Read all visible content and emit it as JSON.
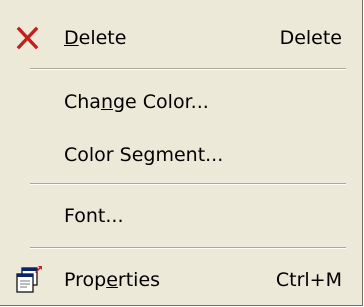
{
  "menu": {
    "items": [
      {
        "label_before": "",
        "label_accel": "D",
        "label_after": "elete",
        "shortcut": "Delete",
        "icon": "delete-x-icon"
      },
      {
        "label_before": "Cha",
        "label_accel": "n",
        "label_after": "ge Color...",
        "shortcut": "",
        "icon": ""
      },
      {
        "label_before": "Color Segment...",
        "label_accel": "",
        "label_after": "",
        "shortcut": "",
        "icon": ""
      },
      {
        "label_before": "Font...",
        "label_accel": "",
        "label_after": "",
        "shortcut": "",
        "icon": ""
      },
      {
        "label_before": "Prop",
        "label_accel": "e",
        "label_after": "rties",
        "shortcut": "Ctrl+M",
        "icon": "properties-icon"
      }
    ]
  },
  "colors": {
    "menu_background": "#ece9d8",
    "delete_icon": "#c41e1e",
    "separator_dark": "#aca899"
  }
}
